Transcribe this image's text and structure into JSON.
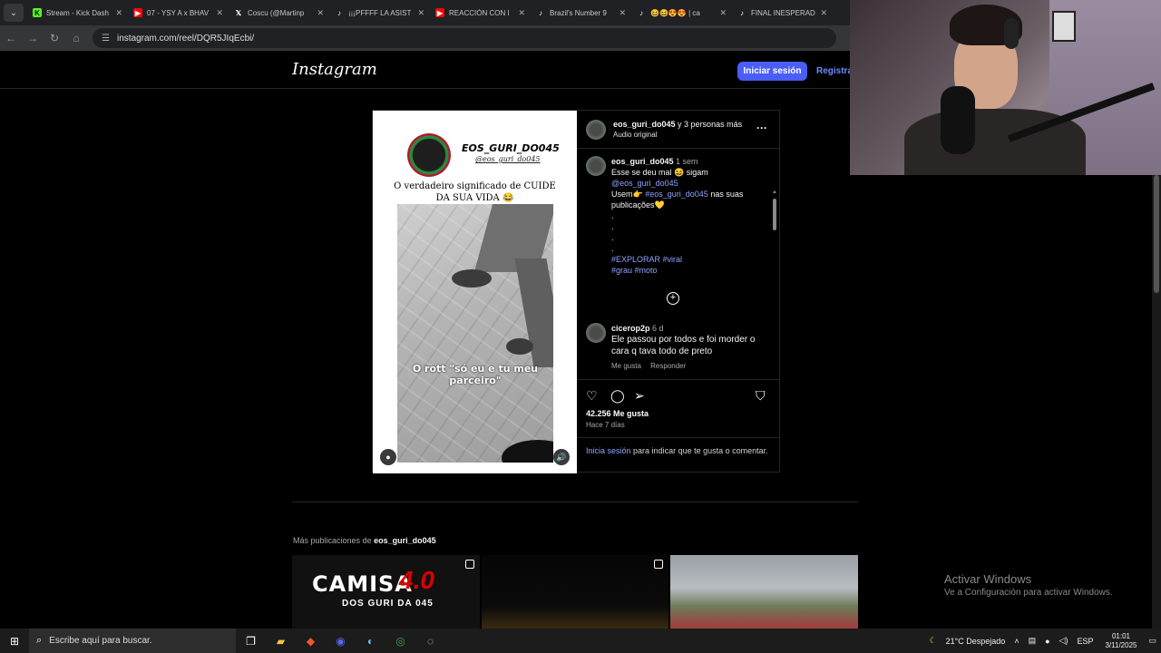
{
  "browser": {
    "tabs": [
      {
        "label": "Stream - Kick Dash",
        "icon": "kick-icon",
        "color": "#53fc18"
      },
      {
        "label": "07 - YSY A x BHAV",
        "icon": "youtube-icon",
        "color": "#ff0000"
      },
      {
        "label": "Coscu (@Martinp",
        "icon": "x-icon",
        "color": "#ffffff"
      },
      {
        "label": "¡¡¡PFFFF LA ASIST",
        "icon": "tiktok-icon",
        "color": "#ffffff"
      },
      {
        "label": "REACCIÓN CON I",
        "icon": "youtube-icon",
        "color": "#ff0000"
      },
      {
        "label": "Brazil's Number 9",
        "icon": "tiktok-icon",
        "color": "#ffffff"
      },
      {
        "label": "😆😆😍😍 | ca",
        "icon": "tiktok-icon",
        "color": "#ffffff"
      },
      {
        "label": "FINAL INESPERAD",
        "icon": "tiktok-icon",
        "color": "#ffffff"
      }
    ],
    "url": "instagram.com/reel/DQR5JIqEcbi/"
  },
  "instagram": {
    "logo": "Instagram",
    "login_button": "Iniciar sesión",
    "register_link": "Registrar",
    "media": {
      "brand_name": "EOS_GURI_DO045",
      "brand_handle": "@eos_guri_do045",
      "caption": "O verdadeiro significado de CUIDE DA SUA VIDA 😂",
      "video_text": "O rott \"só eu e tu meu parceiro\""
    },
    "post": {
      "author": "eos_guri_do045",
      "collab": "y 3 personas más",
      "audio": "Audio original",
      "caption_user": "eos_guri_do045",
      "caption_time": "1 sem",
      "caption_line1": "Esse se deu mal 😆 sigam",
      "caption_mention": "@eos_guri_do045",
      "caption_use": "Usem👉",
      "caption_tag_main": "#eos_guri_do045",
      "caption_line3": "nas suas publicações💛",
      "dots": ".",
      "tags_line1": "#EXPLORAR #viral",
      "tags_line2": "#grau #moto",
      "comment_user": "cicerop2p",
      "comment_time": "6 d",
      "comment_text": "Ele passou por todos e foi morder o cara q tava todo de preto",
      "comment_like": "Me gusta",
      "comment_reply": "Responder",
      "likes": "42.256 Me gusta",
      "ago": "Hace 7 días",
      "login_link": "Inicia sesión",
      "login_text": "para indicar que te gusta o comentar."
    },
    "more": {
      "prefix": "Más publicaciones de",
      "user": "eos_guri_do045",
      "thumb1_title": "CAMISA",
      "thumb1_num": "4.0",
      "thumb1_sub": "DOS GURI DA 045"
    }
  },
  "windows": {
    "activate_title": "Activar Windows",
    "activate_sub": "Ve a Configuración para activar Windows.",
    "search_placeholder": "Escribe aquí para buscar.",
    "weather": "21°C  Despejado",
    "lang": "ESP",
    "time": "01:01",
    "date": "3/11/2025"
  }
}
